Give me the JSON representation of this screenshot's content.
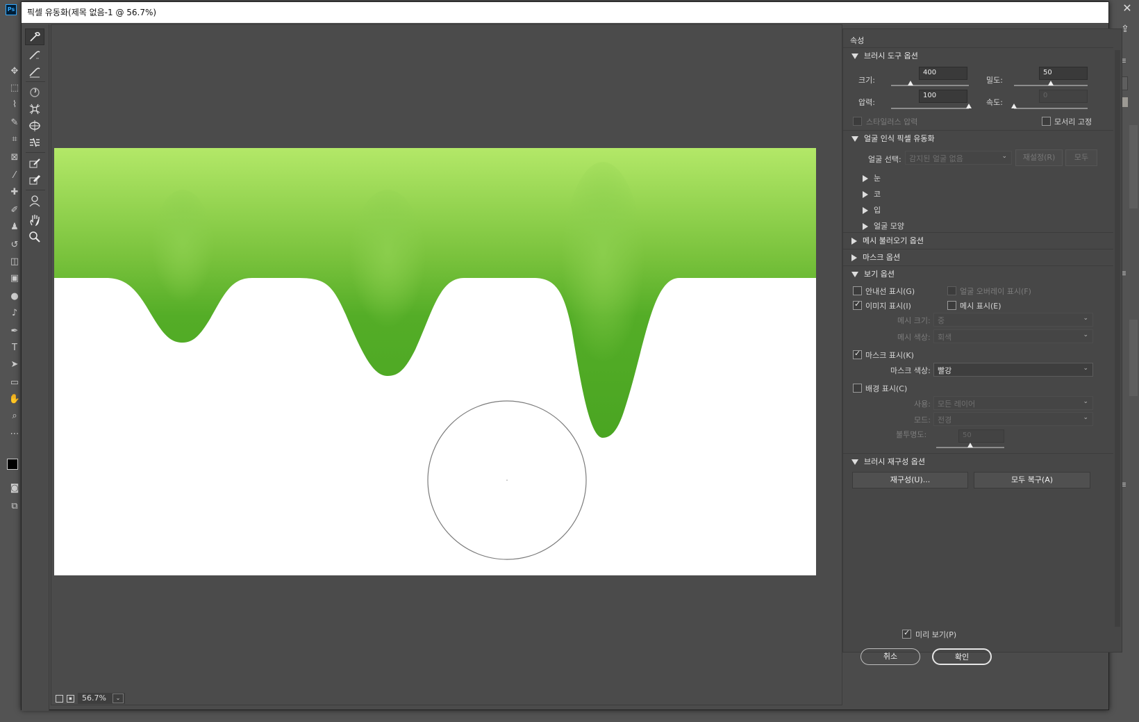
{
  "window": {
    "title": "픽셀 유동화(제목 없음-1 @ 56.7%)"
  },
  "app": {
    "logo": "Ps",
    "close_glyph": "✕"
  },
  "tools": [
    {
      "name": "forward-warp-tool",
      "icon": "forward-warp-icon",
      "active": true
    },
    {
      "name": "reconstruct-tool",
      "icon": "reconstruct-icon"
    },
    {
      "name": "smooth-tool",
      "icon": "smooth-icon"
    },
    {
      "name": "twirl-tool",
      "icon": "twirl-icon"
    },
    {
      "name": "pucker-tool",
      "icon": "pucker-icon"
    },
    {
      "name": "bloat-tool",
      "icon": "bloat-icon"
    },
    {
      "name": "push-left-tool",
      "icon": "push-left-icon"
    },
    {
      "name": "freeze-mask-tool",
      "icon": "freeze-mask-icon"
    },
    {
      "name": "thaw-mask-tool",
      "icon": "thaw-mask-icon"
    },
    {
      "name": "face-tool",
      "icon": "face-icon"
    },
    {
      "name": "hand-tool",
      "icon": "hand-icon"
    },
    {
      "name": "zoom-tool",
      "icon": "zoom-icon"
    }
  ],
  "status": {
    "zoom": "56.7%"
  },
  "properties": {
    "title": "속성",
    "brush_tool_options": {
      "header": "브러시 도구 옵션",
      "size_label": "크기:",
      "size_value": "400",
      "size_level": 0.25,
      "density_label": "밀도:",
      "density_value": "50",
      "density_level": 0.5,
      "pressure_label": "압력:",
      "pressure_value": "100",
      "pressure_level": 1.0,
      "rate_label": "속도:",
      "rate_value": "0",
      "rate_level": 0.0,
      "stylus_pressure_label": "스타일러스 압력",
      "pin_edges_label": "모서리 고정"
    },
    "face_aware": {
      "header": "얼굴 인식 픽셀 유동화",
      "select_face_label": "얼굴 선택:",
      "select_face_value": "감지된 얼굴 없음",
      "reset_button": "재설정(R)",
      "all_button": "모두",
      "subsections": [
        "눈",
        "코",
        "입",
        "얼굴 모양"
      ]
    },
    "load_mesh_header": "메시 불러오기 옵션",
    "mask_options_header": "마스크 옵션",
    "view_options": {
      "header": "보기 옵션",
      "show_guides": "안내선 표시(G)",
      "show_face_overlay": "얼굴 오버레이 표시(F)",
      "show_image": "이미지 표시(I)",
      "show_mesh": "메시 표시(E)",
      "mesh_size_label": "메시 크기:",
      "mesh_size_value": "중",
      "mesh_color_label": "메시 색상:",
      "mesh_color_value": "회색",
      "show_mask": "마스크 표시(K)",
      "mask_color_label": "마스크 색상:",
      "mask_color_value": "빨강",
      "show_backdrop": "배경 표시(C)",
      "use_label": "사용:",
      "use_value": "모든 레이어",
      "mode_label": "모드:",
      "mode_value": "전경",
      "opacity_label": "불투명도:",
      "opacity_value": "50",
      "opacity_level": 0.5
    },
    "brush_reconstruct": {
      "header": "브러시 재구성 옵션",
      "reconstruct_button": "재구성(U)...",
      "restore_all_button": "모두 복구(A)"
    }
  },
  "footer": {
    "preview_label": "미리 보기(P)",
    "cancel_button": "취소",
    "ok_button": "확인"
  },
  "colors": {
    "green_top": "#b3e868",
    "green_mid": "#54ad27",
    "green_deep": "#4aa522"
  }
}
